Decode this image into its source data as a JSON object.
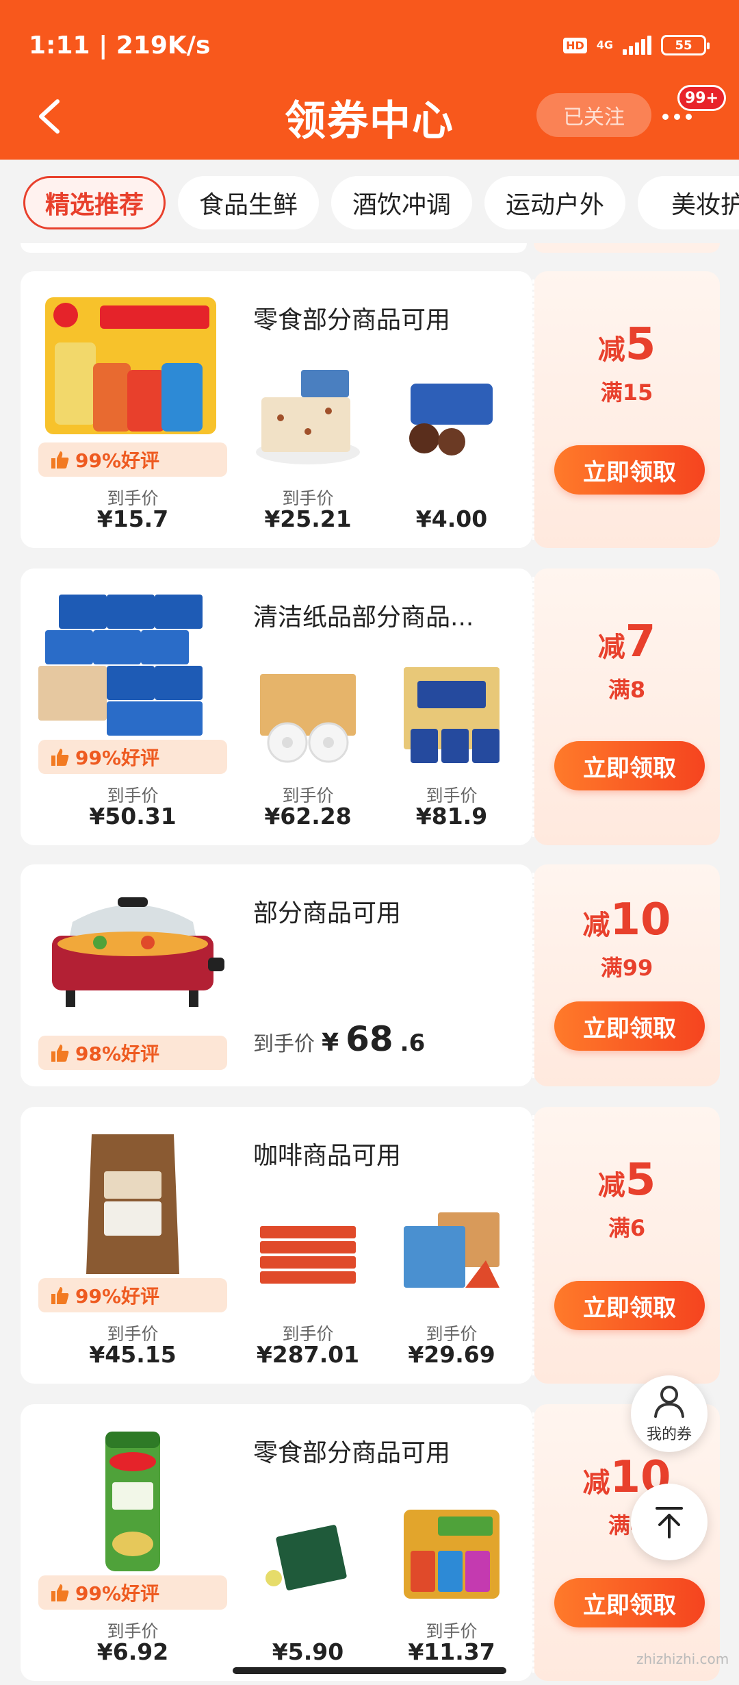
{
  "status": {
    "time": "1:11 | 219K/s",
    "hd": "HD",
    "network": "4G",
    "battery": "55"
  },
  "header": {
    "title": "领券中心",
    "follow_label": "已关注",
    "badge": "99+"
  },
  "tabs": [
    "精选推荐",
    "食品生鲜",
    "酒饮冲调",
    "运动户外",
    "美妆护"
  ],
  "price_label": "到手价",
  "claim_label": "立即领取",
  "minus_label": "减",
  "coupons": [
    {
      "title": "零食部分商品可用",
      "rating": "99%好评",
      "discount": "5",
      "threshold": "满15",
      "prices": [
        "¥15.7",
        "¥25.21",
        "¥4.00"
      ],
      "colors": [
        "#f7c22b",
        "#f1e1c6",
        "#2d5fb8"
      ]
    },
    {
      "title": "清洁纸品部分商品...",
      "rating": "99%好评",
      "discount": "7",
      "threshold": "满8",
      "prices": [
        "¥50.31",
        "¥62.28",
        "¥81.9"
      ],
      "colors": [
        "#1e5bb5",
        "#e6b46a",
        "#254a9e"
      ]
    },
    {
      "title": "部分商品可用",
      "rating": "98%好评",
      "discount": "10",
      "threshold": "满99",
      "price_currency": "¥",
      "price_int": "68",
      "price_dec": ".6",
      "colors": [
        "#b32034"
      ]
    },
    {
      "title": "咖啡商品可用",
      "rating": "99%好评",
      "discount": "5",
      "threshold": "满6",
      "prices": [
        "¥45.15",
        "¥287.01",
        "¥29.69"
      ],
      "colors": [
        "#8a5a32",
        "#e04a2a",
        "#d89a5a"
      ]
    },
    {
      "title": "零食部分商品可用",
      "rating": "99%好评",
      "discount": "10",
      "threshold": "满4",
      "prices": [
        "¥6.92",
        "¥5.90",
        "¥11.37"
      ],
      "colors": [
        "#4fa23a",
        "#1f5a3a",
        "#e2a52c"
      ]
    }
  ],
  "floating": {
    "my_coupon": "我的券"
  },
  "watermark": "zhizhizhi.com"
}
